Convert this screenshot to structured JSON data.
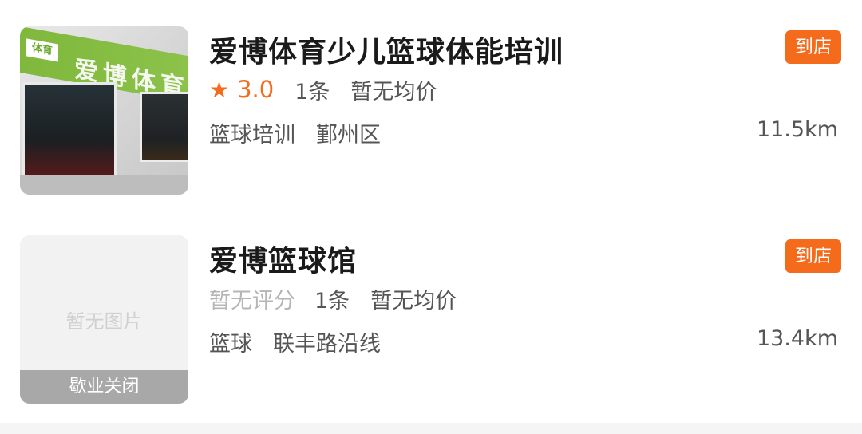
{
  "shops": [
    {
      "name": "爱博体育少儿篮球体能培训",
      "badge": "到店",
      "rating": "3.0",
      "review_count": "1条",
      "avg_price": "暂无均价",
      "category": "篮球培训",
      "area": "鄞州区",
      "distance": "11.5km",
      "photo_sign_text": "爱博体育",
      "photo_tag_text": "体育"
    },
    {
      "name": "爱博篮球馆",
      "badge": "到店",
      "rating_text": "暂无评分",
      "review_count": "1条",
      "avg_price": "暂无均价",
      "category": "篮球",
      "area": "联丰路沿线",
      "distance": "13.4km",
      "no_image_text": "暂无图片",
      "closed_text": "歇业关闭"
    }
  ],
  "colors": {
    "accent": "#f36b1b",
    "closed_bar": "#a8a8a8"
  }
}
